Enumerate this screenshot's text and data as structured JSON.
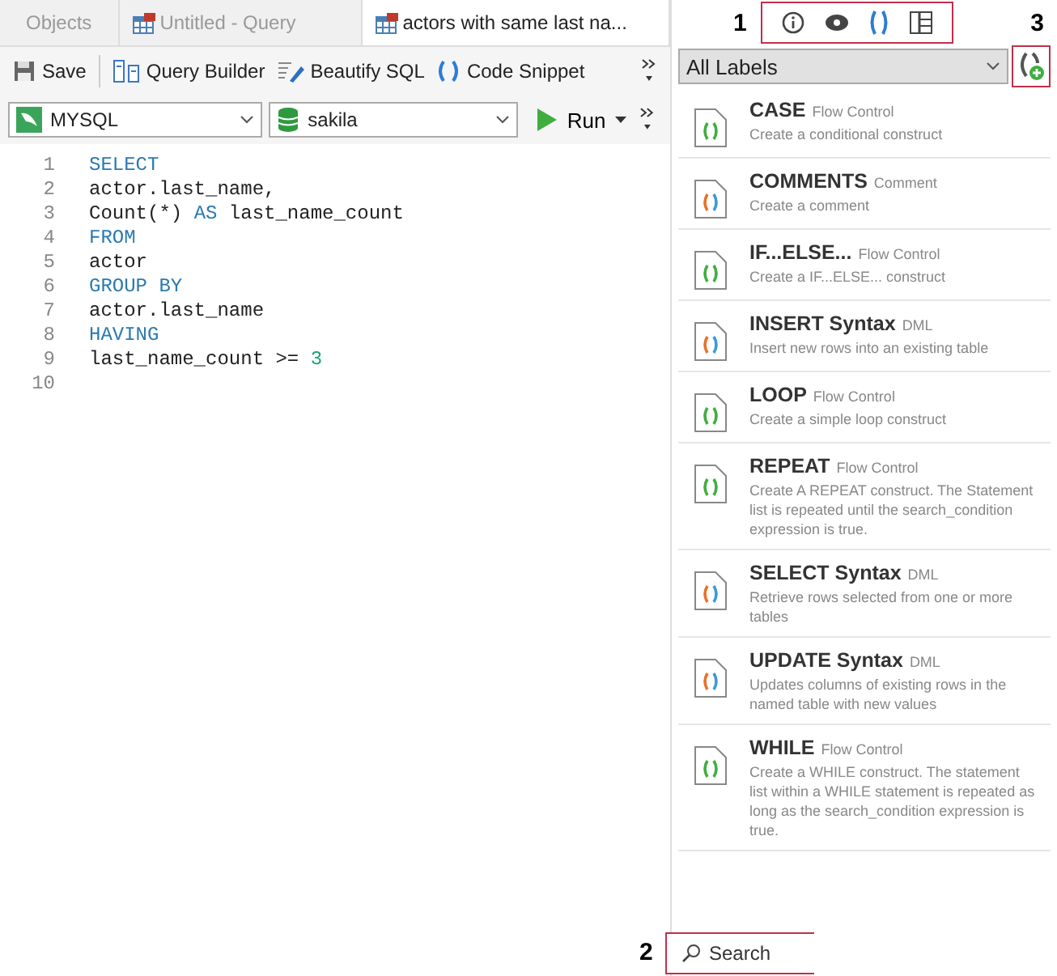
{
  "tabs": [
    {
      "label": "Objects",
      "kind": "plain",
      "selected": false
    },
    {
      "label": "Untitled - Query",
      "kind": "query",
      "selected": false
    },
    {
      "label": "actors with same last na...",
      "kind": "query",
      "selected": true
    }
  ],
  "toolbar": {
    "buttons": [
      {
        "kind": "save",
        "label": "Save"
      },
      {
        "kind": "builder",
        "label": "Query Builder"
      },
      {
        "kind": "beautify",
        "label": "Beautify SQL"
      },
      {
        "kind": "snippet",
        "label": "Code Snippet"
      }
    ]
  },
  "connection": {
    "value": "MYSQL"
  },
  "database": {
    "value": "sakila"
  },
  "run_button": {
    "label": "Run"
  },
  "editor": {
    "lines": [
      {
        "number": "1",
        "tokens": [
          {
            "kind": "keyword",
            "text": "SELECT"
          }
        ]
      },
      {
        "number": "2",
        "tokens": [
          {
            "kind": "plain",
            "text": "actor.last_name,"
          }
        ]
      },
      {
        "number": "3",
        "tokens": [
          {
            "kind": "plain",
            "text": "Count(*) "
          },
          {
            "kind": "keyword",
            "text": "AS"
          },
          {
            "kind": "plain",
            "text": " last_name_count"
          }
        ]
      },
      {
        "number": "4",
        "tokens": [
          {
            "kind": "keyword",
            "text": "FROM"
          }
        ]
      },
      {
        "number": "5",
        "tokens": [
          {
            "kind": "plain",
            "text": "actor"
          }
        ]
      },
      {
        "number": "6",
        "tokens": [
          {
            "kind": "keyword",
            "text": "GROUP BY"
          }
        ]
      },
      {
        "number": "7",
        "tokens": [
          {
            "kind": "plain",
            "text": "actor.last_name"
          }
        ]
      },
      {
        "number": "8",
        "tokens": [
          {
            "kind": "keyword",
            "text": "HAVING"
          }
        ]
      },
      {
        "number": "9",
        "tokens": [
          {
            "kind": "plain",
            "text": "last_name_count >= "
          },
          {
            "kind": "number",
            "text": "3"
          }
        ]
      },
      {
        "number": "10"
      }
    ]
  },
  "snippet_panel": {
    "callouts": [
      {
        "label": "1"
      },
      {
        "label": "3"
      },
      {
        "label": "2"
      }
    ],
    "panel_tabs": [
      {
        "kind": "info",
        "selected": false
      },
      {
        "kind": "preview",
        "selected": false
      },
      {
        "kind": "snippet",
        "selected": true
      },
      {
        "kind": "grid",
        "selected": false
      }
    ],
    "label_filter": {
      "value": "All Labels"
    },
    "snippets": [
      {
        "title": "CASE",
        "category": "Flow Control",
        "description": "Create a conditional construct",
        "kind": "green"
      },
      {
        "title": "COMMENTS",
        "category": "Comment",
        "description": "Create a comment",
        "kind": "multi"
      },
      {
        "title": "IF...ELSE...",
        "category": "Flow Control",
        "description": "Create a IF...ELSE... construct",
        "kind": "green"
      },
      {
        "title": "INSERT Syntax",
        "category": "DML",
        "description": "Insert new rows into an existing table",
        "kind": "multi"
      },
      {
        "title": "LOOP",
        "category": "Flow Control",
        "description": "Create a simple loop construct",
        "kind": "green"
      },
      {
        "title": "REPEAT",
        "category": "Flow Control",
        "description": "Create A REPEAT construct. The Statement list is repeated until the search_condition expression is true.",
        "kind": "green"
      },
      {
        "title": "SELECT Syntax",
        "category": "DML",
        "description": "Retrieve rows selected from one or more tables",
        "kind": "multi"
      },
      {
        "title": "UPDATE Syntax",
        "category": "DML",
        "description": "Updates columns of existing rows in the named table with new values",
        "kind": "multi"
      },
      {
        "title": "WHILE",
        "category": "Flow Control",
        "description": "Create a WHILE construct. The statement list within a WHILE statement is repeated as long as the search_condition expression is true.",
        "kind": "green"
      }
    ],
    "search": {
      "placeholder": "Search"
    }
  }
}
